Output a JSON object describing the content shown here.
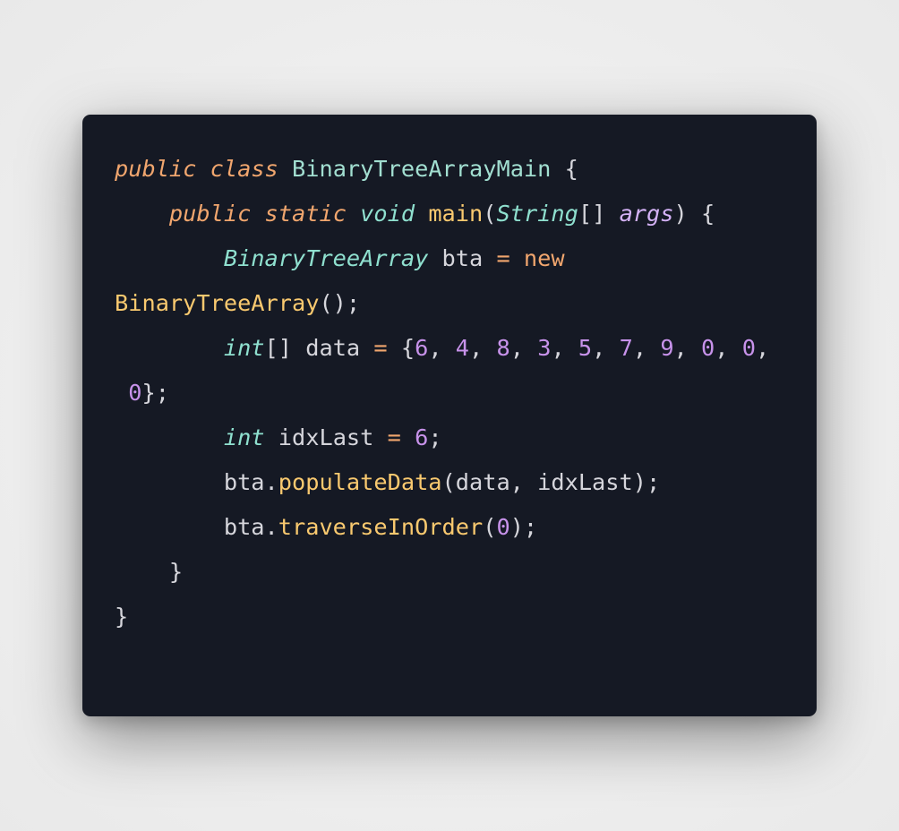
{
  "code_snippet": {
    "language": "java",
    "lines": [
      [
        {
          "t": "public",
          "k": "kw"
        },
        {
          "t": " ",
          "k": "pl"
        },
        {
          "t": "class",
          "k": "kw"
        },
        {
          "t": " ",
          "k": "pl"
        },
        {
          "t": "BinaryTreeArrayMain",
          "k": "cls"
        },
        {
          "t": " {",
          "k": "pl"
        }
      ],
      [
        {
          "t": "    ",
          "k": "pl"
        },
        {
          "t": "public",
          "k": "kw"
        },
        {
          "t": " ",
          "k": "pl"
        },
        {
          "t": "static",
          "k": "kw"
        },
        {
          "t": " ",
          "k": "pl"
        },
        {
          "t": "void",
          "k": "type"
        },
        {
          "t": " ",
          "k": "pl"
        },
        {
          "t": "main",
          "k": "fn"
        },
        {
          "t": "(",
          "k": "pl"
        },
        {
          "t": "String",
          "k": "type"
        },
        {
          "t": "[] ",
          "k": "pl"
        },
        {
          "t": "args",
          "k": "par"
        },
        {
          "t": ") {",
          "k": "pl"
        }
      ],
      [
        {
          "t": "        ",
          "k": "pl"
        },
        {
          "t": "BinaryTreeArray",
          "k": "type"
        },
        {
          "t": " bta ",
          "k": "pl"
        },
        {
          "t": "=",
          "k": "op"
        },
        {
          "t": " ",
          "k": "pl"
        },
        {
          "t": "new",
          "k": "kwn"
        }
      ],
      [
        {
          "t": "BinaryTreeArray",
          "k": "fn"
        },
        {
          "t": "();",
          "k": "pl"
        }
      ],
      [
        {
          "t": "        ",
          "k": "pl"
        },
        {
          "t": "int",
          "k": "type"
        },
        {
          "t": "[] data ",
          "k": "pl"
        },
        {
          "t": "=",
          "k": "op"
        },
        {
          "t": " {",
          "k": "pl"
        },
        {
          "t": "6",
          "k": "num"
        },
        {
          "t": ", ",
          "k": "pl"
        },
        {
          "t": "4",
          "k": "num"
        },
        {
          "t": ", ",
          "k": "pl"
        },
        {
          "t": "8",
          "k": "num"
        },
        {
          "t": ", ",
          "k": "pl"
        },
        {
          "t": "3",
          "k": "num"
        },
        {
          "t": ", ",
          "k": "pl"
        },
        {
          "t": "5",
          "k": "num"
        },
        {
          "t": ", ",
          "k": "pl"
        },
        {
          "t": "7",
          "k": "num"
        },
        {
          "t": ", ",
          "k": "pl"
        },
        {
          "t": "9",
          "k": "num"
        },
        {
          "t": ", ",
          "k": "pl"
        },
        {
          "t": "0",
          "k": "num"
        },
        {
          "t": ", ",
          "k": "pl"
        },
        {
          "t": "0",
          "k": "num"
        },
        {
          "t": ",",
          "k": "pl"
        }
      ],
      [
        {
          "t": " ",
          "k": "pl"
        },
        {
          "t": "0",
          "k": "num"
        },
        {
          "t": "};",
          "k": "pl"
        }
      ],
      [
        {
          "t": "        ",
          "k": "pl"
        },
        {
          "t": "int",
          "k": "type"
        },
        {
          "t": " idxLast ",
          "k": "pl"
        },
        {
          "t": "=",
          "k": "op"
        },
        {
          "t": " ",
          "k": "pl"
        },
        {
          "t": "6",
          "k": "num"
        },
        {
          "t": ";",
          "k": "pl"
        }
      ],
      [
        {
          "t": "        bta.",
          "k": "pl"
        },
        {
          "t": "populateData",
          "k": "fn"
        },
        {
          "t": "(data, idxLast);",
          "k": "pl"
        }
      ],
      [
        {
          "t": "        bta.",
          "k": "pl"
        },
        {
          "t": "traverseInOrder",
          "k": "fn"
        },
        {
          "t": "(",
          "k": "pl"
        },
        {
          "t": "0",
          "k": "num"
        },
        {
          "t": ");",
          "k": "pl"
        }
      ],
      [
        {
          "t": "    }",
          "k": "pl"
        }
      ],
      [
        {
          "t": "}",
          "k": "pl"
        }
      ]
    ]
  }
}
